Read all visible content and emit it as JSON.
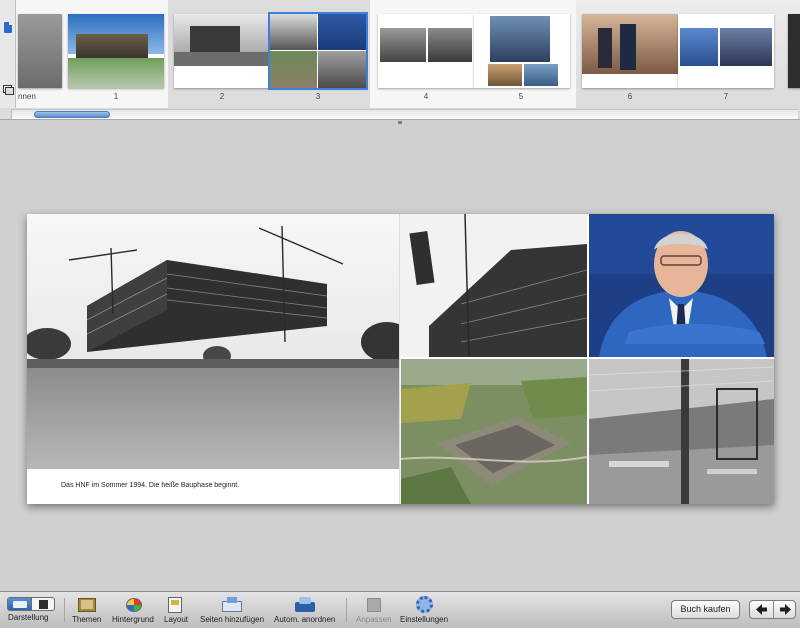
{
  "page_browser": {
    "cover_label": "nnen",
    "page_numbers": [
      "1",
      "2",
      "3",
      "4",
      "5",
      "6",
      "7"
    ],
    "selected_pages": [
      "2",
      "3"
    ]
  },
  "spread": {
    "left_caption": "Das HNF im Sommer 1994. Die heiße Bauphase beginnt."
  },
  "toolbar": {
    "view_label": "Darstellung",
    "themes_label": "Themen",
    "background_label": "Hintergrund",
    "layout_label": "Layout",
    "add_pages_label": "Seiten hinzufügen",
    "autoflow_label": "Autom. anordnen",
    "adjust_label": "Anpassen",
    "settings_label": "Einstellungen",
    "buy_book_label": "Buch kaufen"
  },
  "icons": {
    "view_book": "book-view-icon",
    "view_pages": "pages-view-icon",
    "themes": "themes-icon",
    "background": "background-palette-icon",
    "layout": "layout-icon",
    "add_pages": "add-pages-icon",
    "autoflow": "autoflow-icon",
    "adjust": "adjust-icon",
    "settings": "gear-icon",
    "prev": "arrow-left-icon",
    "next": "arrow-right-icon"
  },
  "colors": {
    "accent": "#3d7fd9",
    "toolbar_top": "#e4e4e4",
    "toolbar_bottom": "#bdbdbd",
    "canvas": "#d0d0d0"
  }
}
